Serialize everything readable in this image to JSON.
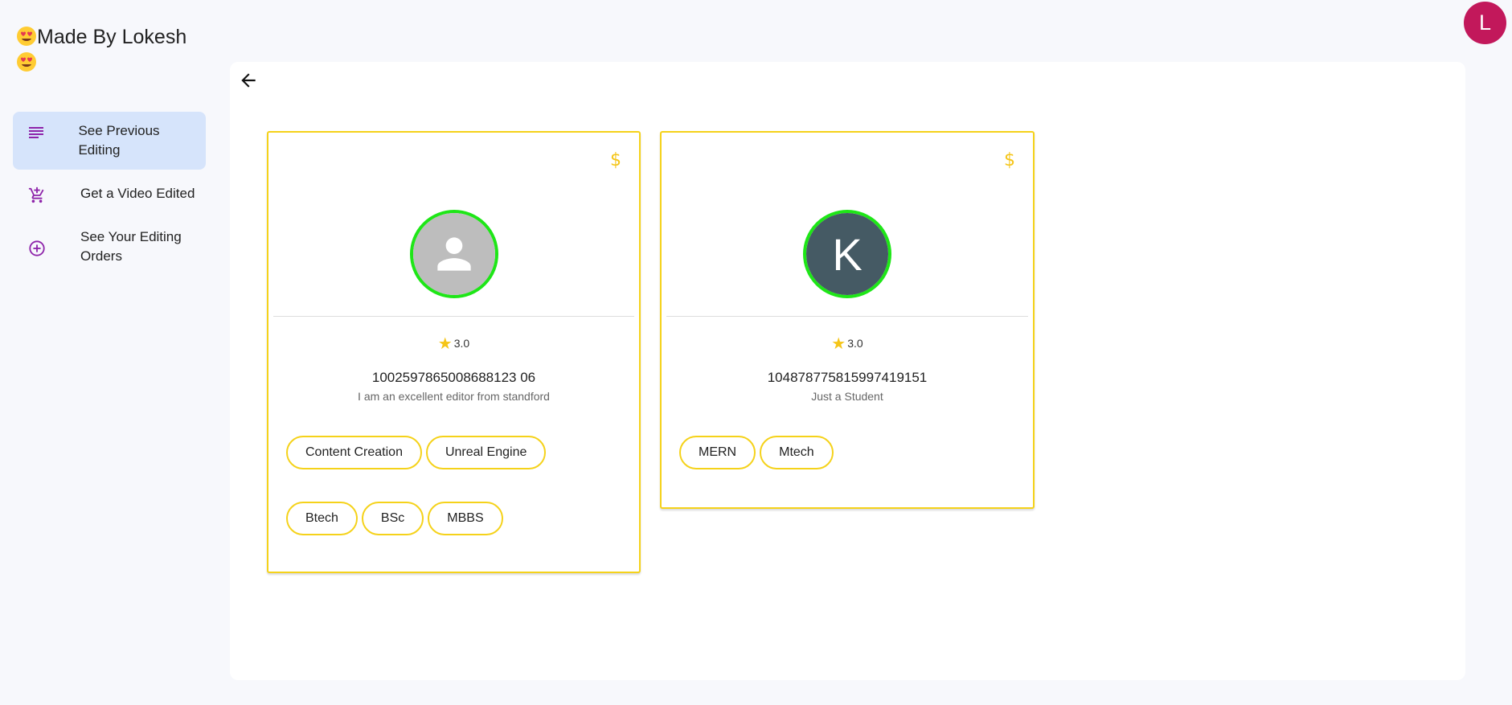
{
  "brand": {
    "title": "Made By Lokesh"
  },
  "user": {
    "avatar_letter": "L",
    "avatar_color": "#c2185b"
  },
  "sidebar": {
    "items": [
      {
        "label": "See Previous Editing",
        "icon": "list-lines-icon",
        "active": true
      },
      {
        "label": "Get a Video Edited",
        "icon": "add-to-cart-icon",
        "active": false
      },
      {
        "label": "See Your Editing Orders",
        "icon": "add-circle-icon",
        "active": false
      }
    ]
  },
  "main": {
    "back_icon": "back-arrow-icon",
    "cards": [
      {
        "price_icon": "$",
        "avatar": "default-person",
        "rating": "3.0",
        "editor_id": "1002597865008688123 06",
        "bio": "I am an excellent editor from standford",
        "skills": [
          "Content Creation",
          "Unreal Engine"
        ],
        "qualifications": [
          "Btech",
          "BSc",
          "MBBS"
        ]
      },
      {
        "price_icon": "$",
        "avatar_letter": "K",
        "rating": "3.0",
        "editor_id": "104878775815997419151",
        "bio": "Just a Student",
        "skills": [
          "MERN",
          "Mtech"
        ],
        "qualifications": []
      }
    ]
  },
  "colors": {
    "accent": "#f5d21a",
    "avatar_ring": "#1ee617",
    "nav_icon": "#8e24aa",
    "active_nav_bg": "#d6e4fb"
  }
}
